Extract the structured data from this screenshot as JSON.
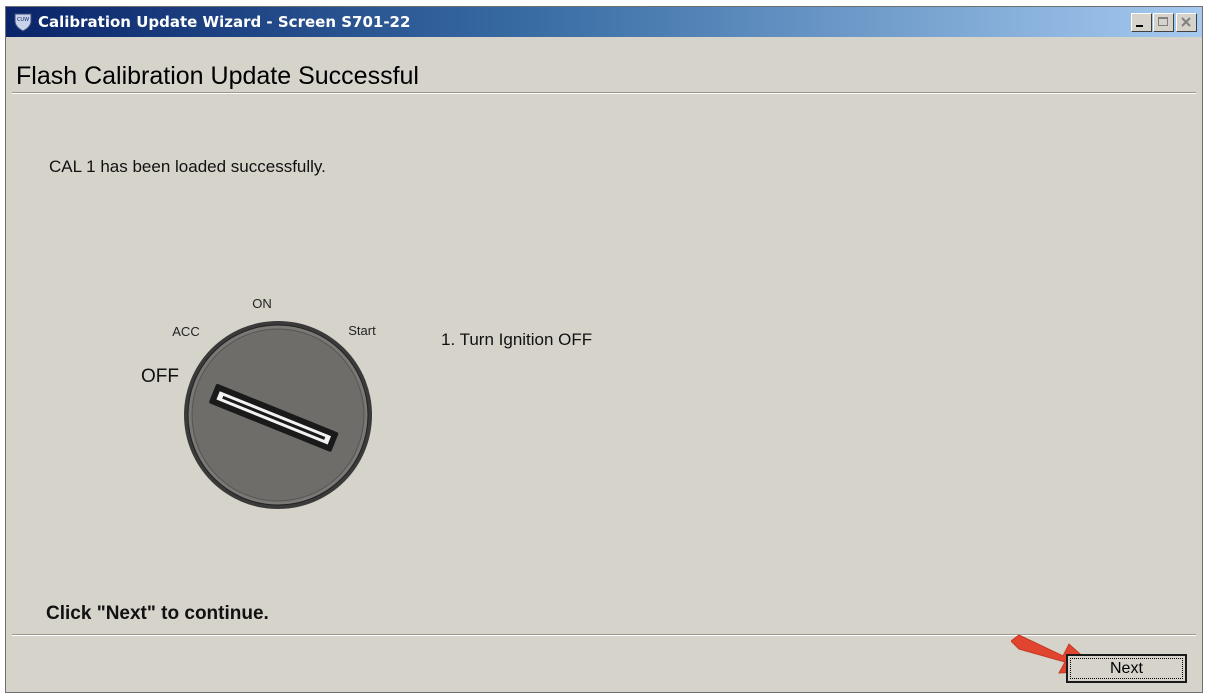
{
  "window": {
    "title": "Calibration Update Wizard - Screen S701-22",
    "app_icon_text": "CUW",
    "titlebar_gradient": [
      "#0a246a",
      "#3a6ea5",
      "#a6caf0"
    ],
    "controls": [
      "minimize-icon",
      "maximize-icon",
      "close-icon"
    ]
  },
  "page": {
    "heading": "Flash Calibration Update Successful",
    "message": "CAL 1 has been loaded successfully.",
    "ignition": {
      "labels": {
        "off": "OFF",
        "acc": "ACC",
        "on": "ON",
        "start": "Start"
      },
      "knob_color": "#6f6d69"
    },
    "step": "1. Turn Ignition OFF",
    "continue_text": "Click \"Next\" to continue."
  },
  "footer": {
    "next_label": "Next",
    "pointer_color": "#e2452f"
  }
}
